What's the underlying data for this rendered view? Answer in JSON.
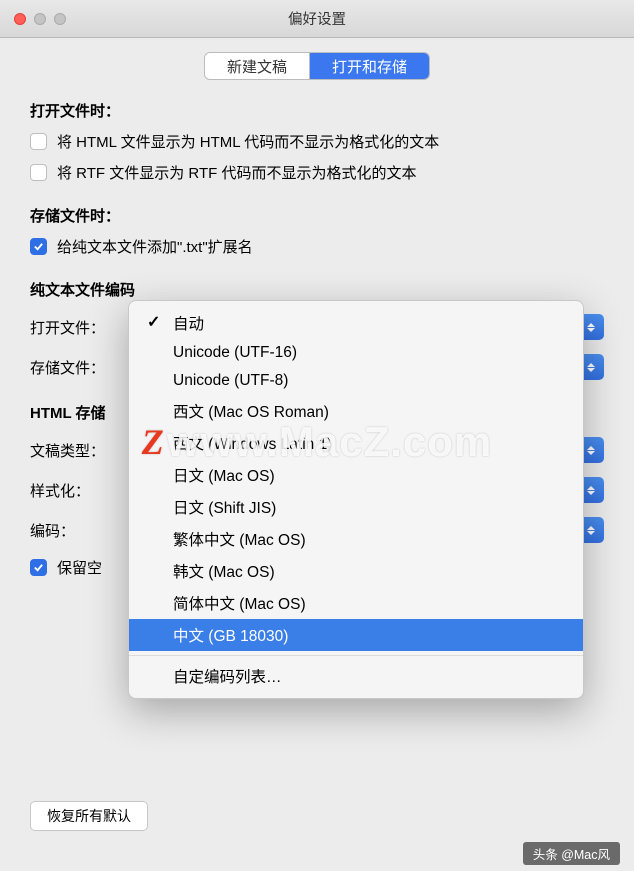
{
  "window": {
    "title": "偏好设置"
  },
  "tabs": {
    "new_doc": "新建文稿",
    "open_save": "打开和存储"
  },
  "open_file": {
    "heading": "打开文件时：",
    "html_code": "将 HTML 文件显示为 HTML 代码而不显示为格式化的文本",
    "rtf_code": "将 RTF 文件显示为 RTF 代码而不显示为格式化的文本"
  },
  "save_file": {
    "heading": "存储文件时：",
    "txt_ext": "给纯文本文件添加\".txt\"扩展名"
  },
  "plain_text": {
    "heading": "纯文本文件编码",
    "open_label": "打开文件：",
    "save_label": "存储文件："
  },
  "html_save": {
    "heading": "HTML 存储",
    "doc_type_label": "文稿类型：",
    "style_label": "样式化：",
    "encoding_label": "编码：",
    "preserve_blank": "保留空"
  },
  "dropdown": {
    "items": [
      "自动",
      "Unicode (UTF-16)",
      "Unicode (UTF-8)",
      "西文 (Mac OS Roman)",
      "西文 (Windows Latin 1)",
      "日文 (Mac OS)",
      "日文 (Shift JIS)",
      "繁体中文 (Mac OS)",
      "韩文 (Mac OS)",
      "简体中文 (Mac OS)",
      "中文 (GB 18030)"
    ],
    "custom": "自定编码列表…",
    "selected": "自动",
    "highlighted": "中文 (GB 18030)"
  },
  "restore_button": "恢复所有默认",
  "watermark": "www.MacZ.com",
  "footer": "头条 @Mac风"
}
